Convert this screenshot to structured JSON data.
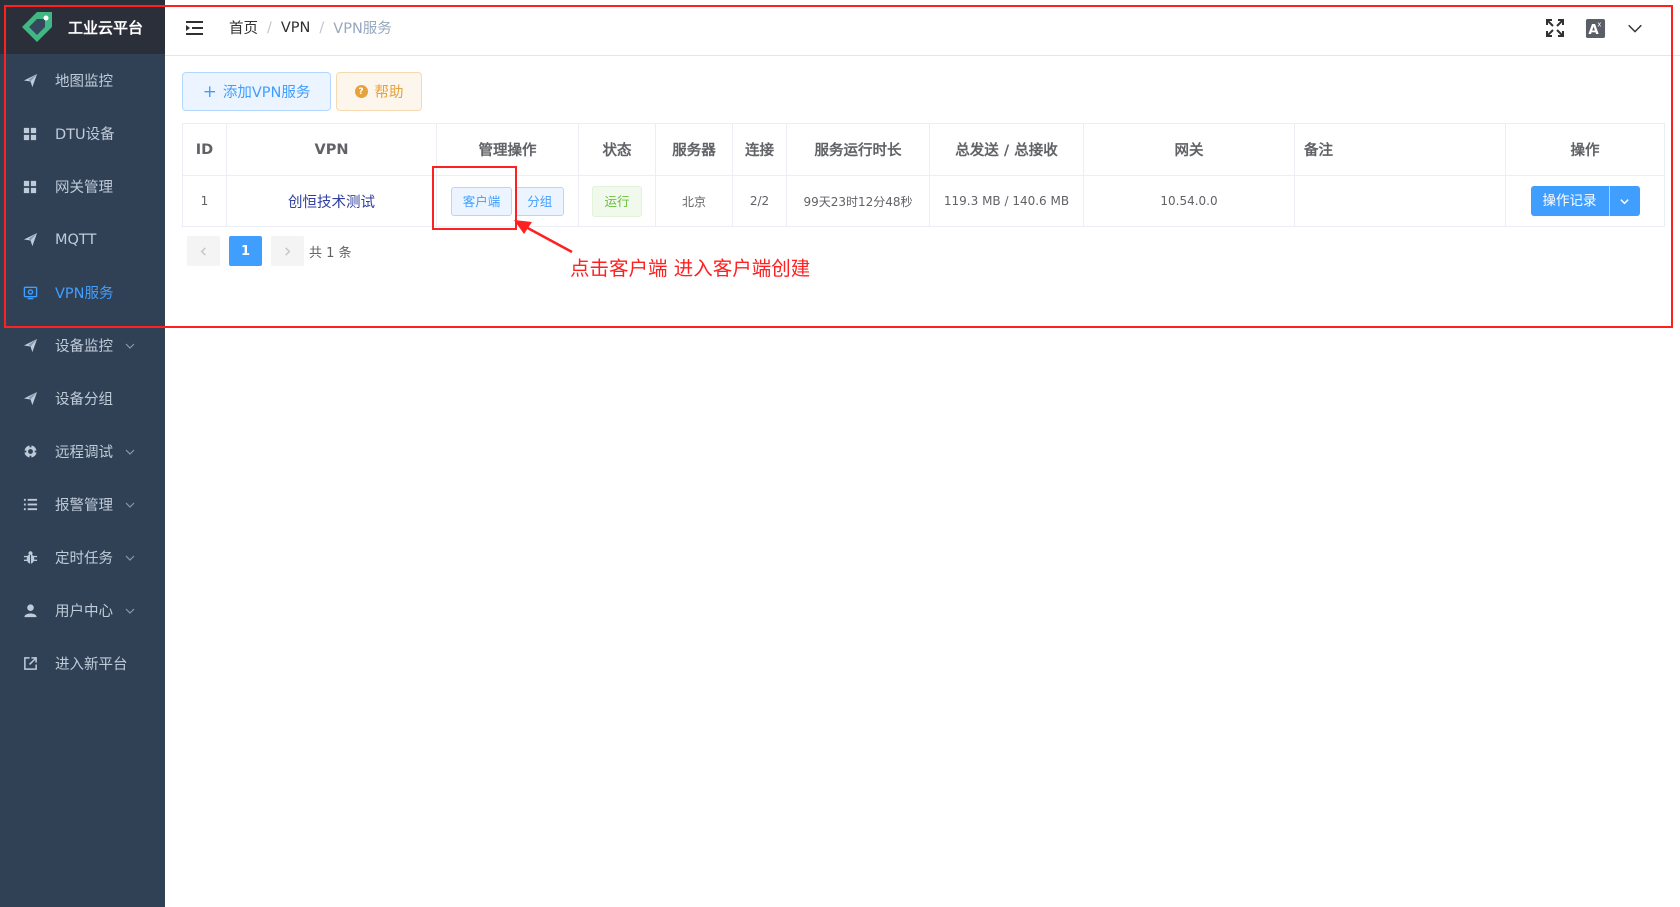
{
  "app": {
    "title": "工业云平台"
  },
  "sidebar": {
    "items": [
      {
        "label": "地图监控",
        "icon": "paper-plane-icon",
        "active": false,
        "has_children": false
      },
      {
        "label": "DTU设备",
        "icon": "grid-icon",
        "active": false,
        "has_children": false
      },
      {
        "label": "网关管理",
        "icon": "grid-icon",
        "active": false,
        "has_children": false
      },
      {
        "label": "MQTT",
        "icon": "paper-plane-icon",
        "active": false,
        "has_children": false
      },
      {
        "label": "VPN服务",
        "icon": "monitor-icon",
        "active": true,
        "has_children": false
      },
      {
        "label": "设备监控",
        "icon": "paper-plane-icon",
        "active": false,
        "has_children": true
      },
      {
        "label": "设备分组",
        "icon": "paper-plane-icon",
        "active": false,
        "has_children": false
      },
      {
        "label": "远程调试",
        "icon": "gear-ring-icon",
        "active": false,
        "has_children": true
      },
      {
        "label": "报警管理",
        "icon": "list-icon",
        "active": false,
        "has_children": true
      },
      {
        "label": "定时任务",
        "icon": "bug-icon",
        "active": false,
        "has_children": true
      },
      {
        "label": "用户中心",
        "icon": "user-icon",
        "active": false,
        "has_children": true
      },
      {
        "label": "进入新平台",
        "icon": "external-link-icon",
        "active": false,
        "has_children": false
      }
    ]
  },
  "breadcrumb": {
    "home": "首页",
    "section": "VPN",
    "current": "VPN服务",
    "separator": "/"
  },
  "toolbar": {
    "add_label": "添加VPN服务",
    "help_label": "帮助"
  },
  "table": {
    "headers": {
      "id": "ID",
      "vpn": "VPN",
      "manage": "管理操作",
      "status": "状态",
      "server": "服务器",
      "connections": "连接",
      "uptime": "服务运行时长",
      "traffic": "总发送 / 总接收",
      "gateway": "网关",
      "remark": "备注",
      "actions": "操作"
    },
    "rows": [
      {
        "id": "1",
        "vpn": "创恒技术测试",
        "client_btn": "客户端",
        "group_btn": "分组",
        "status": "运行",
        "server": "北京",
        "connections": "2/2",
        "uptime": "99天23时12分48秒",
        "traffic": "119.3 MB / 140.6 MB",
        "gateway": "10.54.0.0",
        "remark": "",
        "action_label": "操作记录"
      }
    ]
  },
  "pagination": {
    "current_page": "1",
    "total_text": "共 1 条"
  },
  "annotation": {
    "text": "点击客户端 进入客户端创建"
  },
  "colors": {
    "sidebar_bg": "#304156",
    "logo_bg": "#2b2f3a",
    "primary": "#409eff",
    "warning": "#e6a23c",
    "success": "#67c23a",
    "annotation": "#ff2020",
    "link": "#303f9f"
  }
}
